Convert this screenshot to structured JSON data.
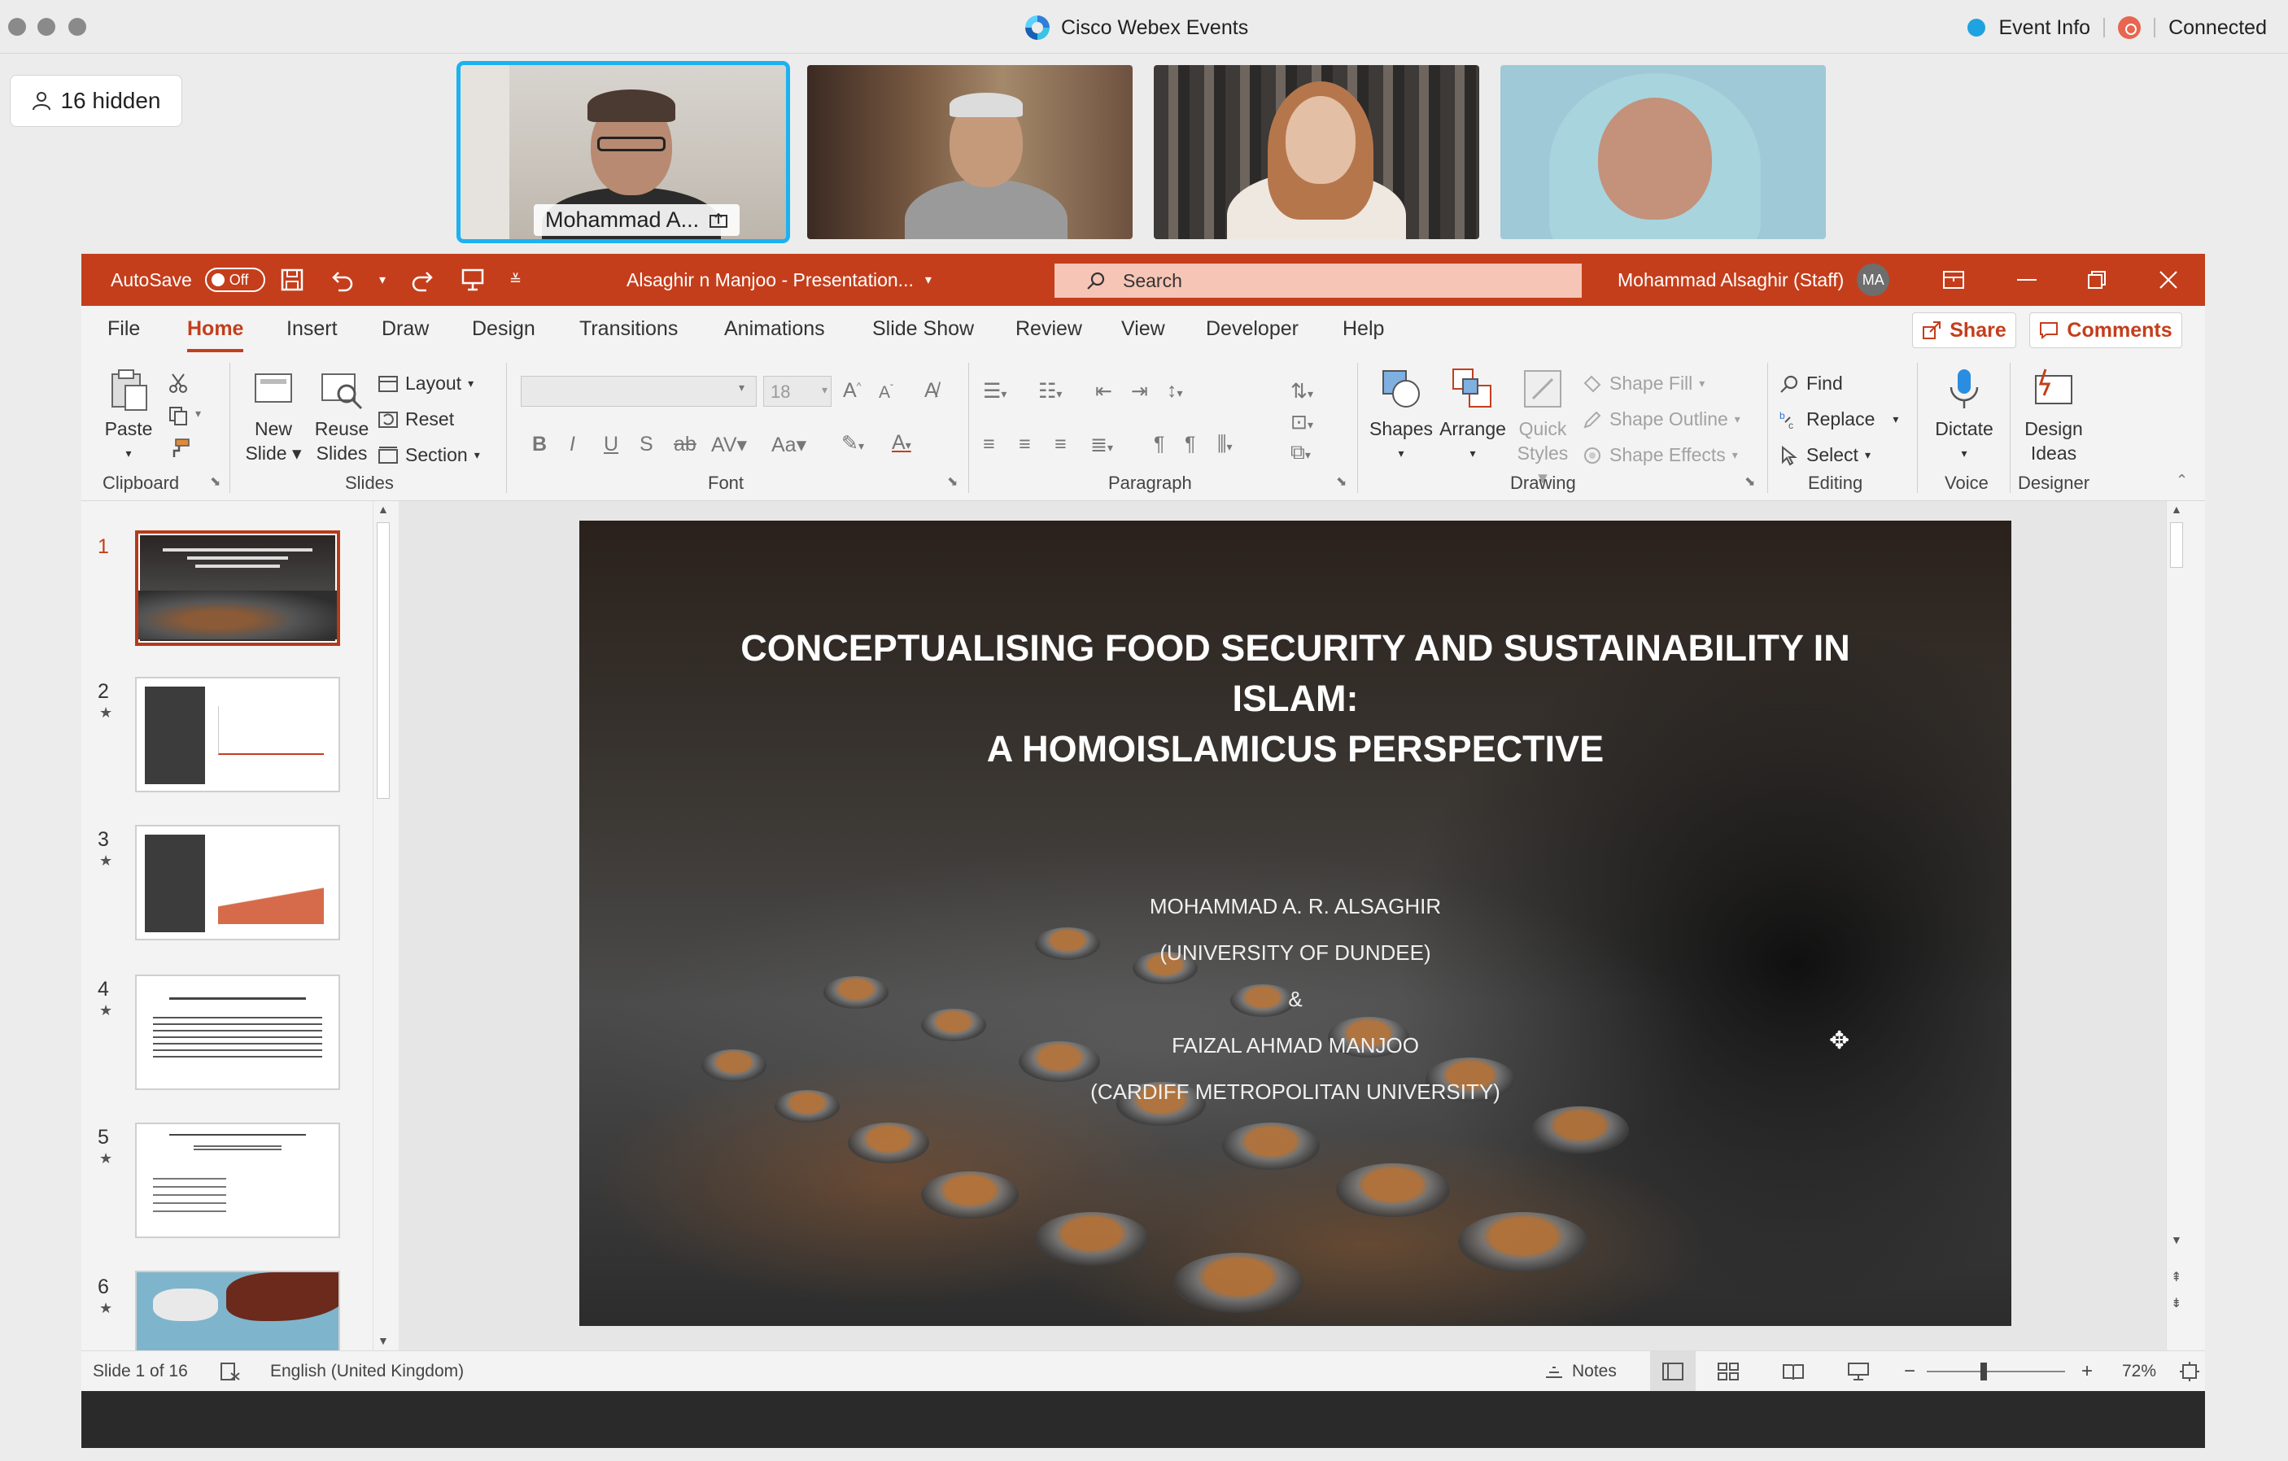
{
  "webex": {
    "title": "Cisco Webex Events",
    "event_info": "Event Info",
    "connection": "Connected",
    "hidden_count": "16 hidden",
    "active_speaker": "Mohammad A..."
  },
  "ppt": {
    "autosave_label": "AutoSave",
    "autosave_state": "Off",
    "file_title": "Alsaghir n Manjoo - Presentation...",
    "search_placeholder": "Search",
    "user_name": "Mohammad Alsaghir (Staff)",
    "user_initials": "MA",
    "tabs": [
      "File",
      "Home",
      "Insert",
      "Draw",
      "Design",
      "Transitions",
      "Animations",
      "Slide Show",
      "Review",
      "View",
      "Developer",
      "Help"
    ],
    "share_label": "Share",
    "comments_label": "Comments",
    "ribbon": {
      "paste": "Paste",
      "clipboard": "Clipboard",
      "new_slide_1": "New",
      "new_slide_2": "Slide",
      "reuse_1": "Reuse",
      "reuse_2": "Slides",
      "layout": "Layout",
      "reset": "Reset",
      "section": "Section",
      "slides": "Slides",
      "font_size": "18",
      "font": "Font",
      "paragraph": "Paragraph",
      "shapes": "Shapes",
      "arrange": "Arrange",
      "quick_1": "Quick",
      "quick_2": "Styles",
      "shape_fill": "Shape Fill",
      "shape_outline": "Shape Outline",
      "shape_effects": "Shape Effects",
      "drawing": "Drawing",
      "find": "Find",
      "replace": "Replace",
      "select": "Select",
      "editing": "Editing",
      "dictate": "Dictate",
      "voice": "Voice",
      "design_1": "Design",
      "design_2": "Ideas",
      "designer": "Designer"
    },
    "thumbnails": [
      "1",
      "2",
      "3",
      "4",
      "5",
      "6"
    ],
    "slide": {
      "title_1": "CONCEPTUALISING FOOD SECURITY AND SUSTAINABILITY IN",
      "title_2": "ISLAM:",
      "title_3": "A HOMOISLAMICUS PERSPECTIVE",
      "author_1": "MOHAMMAD A. R. ALSAGHIR",
      "affil_1": "(UNIVERSITY OF DUNDEE)",
      "amp": "&",
      "author_2": "FAIZAL AHMAD MANJOO",
      "affil_2": "(CARDIFF METROPOLITAN UNIVERSITY)"
    },
    "status": {
      "slide_info": "Slide 1 of 16",
      "language": "English (United Kingdom)",
      "notes": "Notes",
      "zoom": "72%"
    }
  },
  "colors": {
    "accent": "#c43e1c",
    "webex_highlight": "#1bb2f0"
  }
}
